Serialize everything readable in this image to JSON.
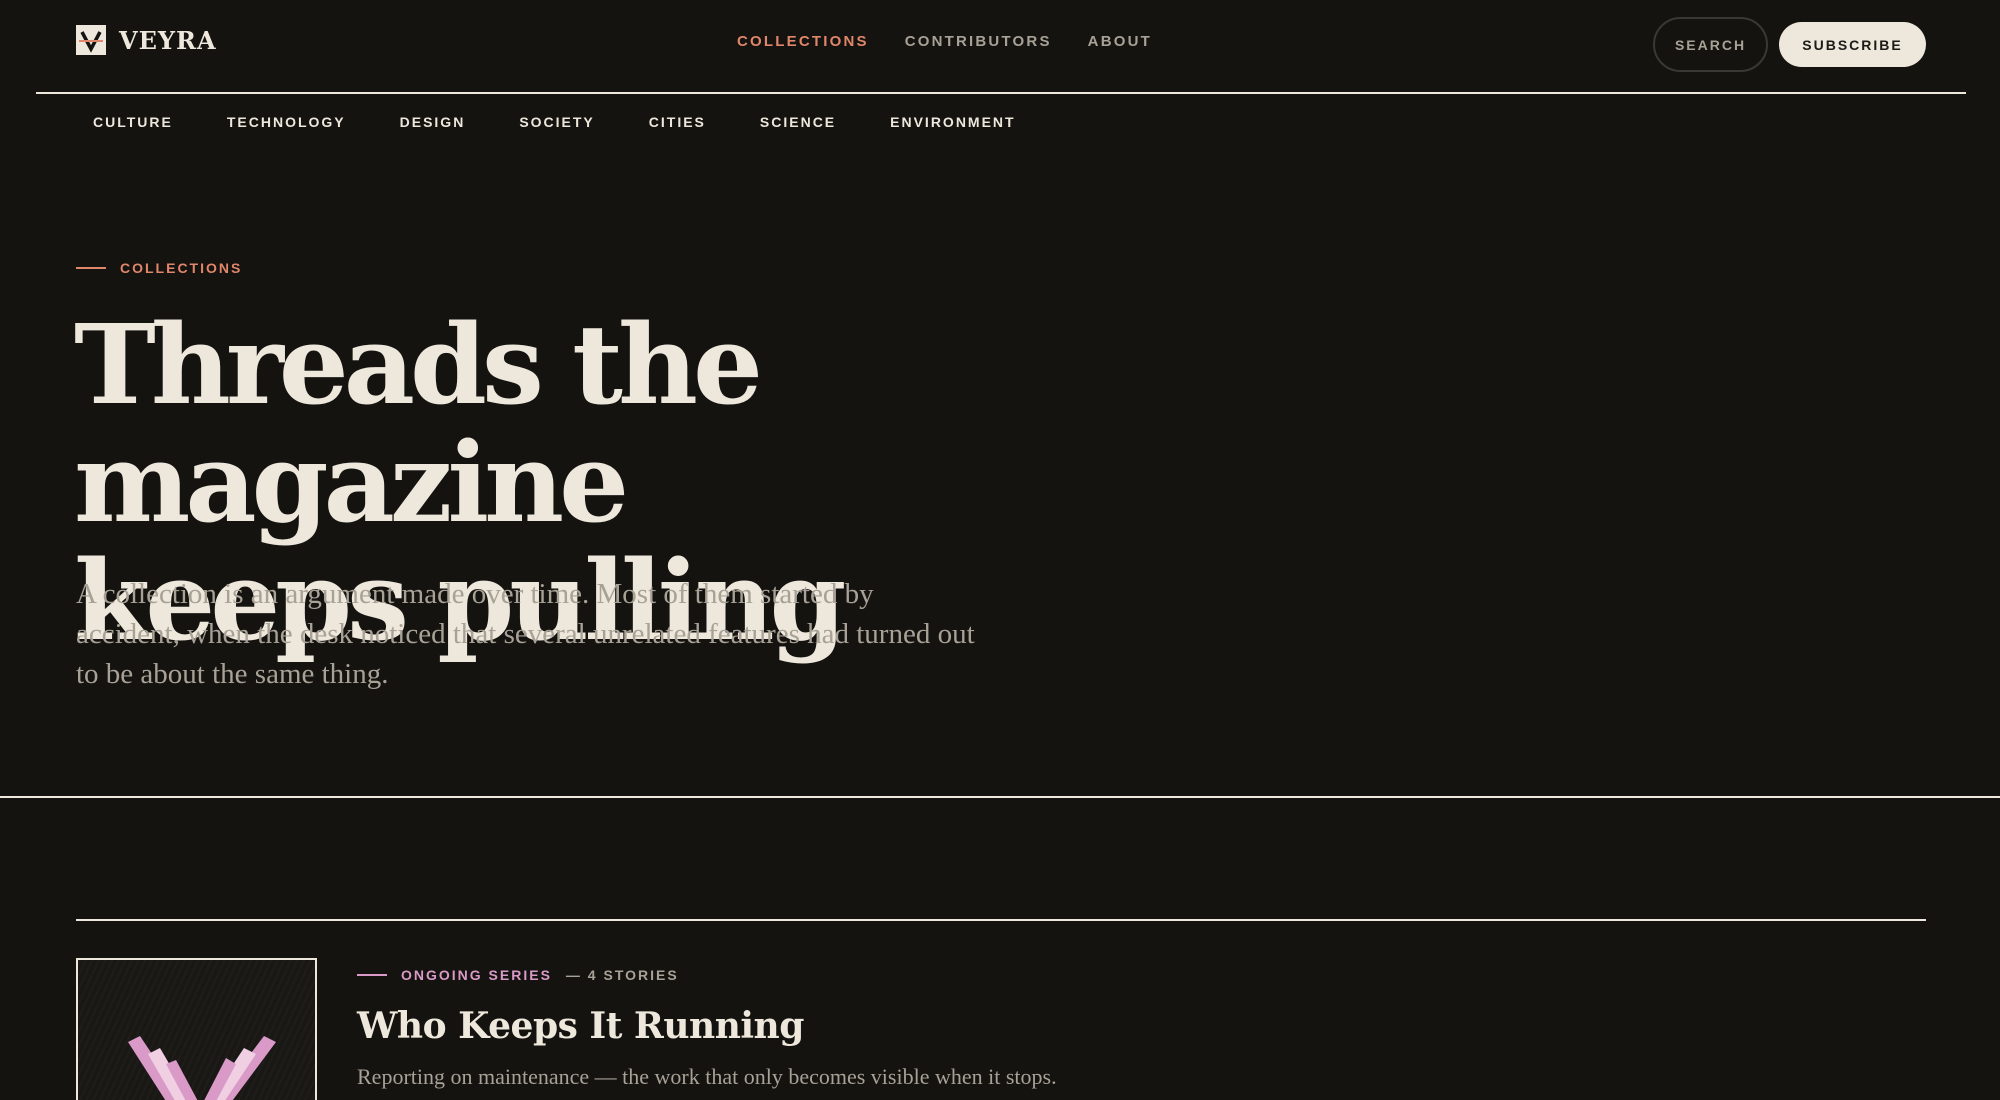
{
  "brand": {
    "name": "VEYRA",
    "logo_icon": "v-monogram-icon"
  },
  "main_nav": {
    "items": [
      {
        "label": "COLLECTIONS",
        "active": true
      },
      {
        "label": "CONTRIBUTORS",
        "active": false
      },
      {
        "label": "ABOUT",
        "active": false
      }
    ]
  },
  "actions": {
    "search_label": "SEARCH",
    "subscribe_label": "SUBSCRIBE"
  },
  "category_nav": {
    "items": [
      "CULTURE",
      "TECHNOLOGY",
      "DESIGN",
      "SOCIETY",
      "CITIES",
      "SCIENCE",
      "ENVIRONMENT"
    ]
  },
  "hero": {
    "eyebrow": "COLLECTIONS",
    "title_line1": "Threads the magazine",
    "title_line2": "keeps pulling",
    "lede": "A collection is an argument made over time. Most of them started by accident, when the desk noticed that several unrelated features had turned out to be about the same thing."
  },
  "collections": [
    {
      "kicker": "ONGOING SERIES",
      "count": "— 4 STORIES",
      "title": "Who Keeps It Running",
      "description": "Reporting on maintenance — the work that only becomes visible when it stops.",
      "thumbnail_icon": "layered-v-chevron-icon"
    }
  ],
  "colors": {
    "background": "#141310",
    "text": "#ede7dc",
    "muted": "#a8a196",
    "accent_orange": "#e0866a",
    "accent_pink": "#d99ac8"
  }
}
